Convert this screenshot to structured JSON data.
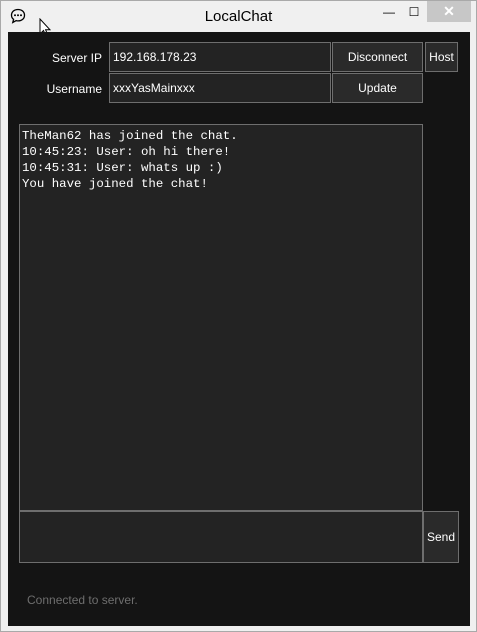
{
  "window": {
    "title": "LocalChat",
    "minimize_glyph": "—",
    "maximize_glyph": "☐",
    "close_glyph": "✕"
  },
  "form": {
    "server_ip_label": "Server IP",
    "server_ip_value": "192.168.178.23",
    "username_label": "Username",
    "username_value": "xxxYasMainxxx",
    "disconnect_label": "Disconnect",
    "host_label": "Host",
    "update_label": "Update"
  },
  "chat": {
    "lines": [
      "TheMan62 has joined the chat.",
      "10:45:23: User: oh hi there!",
      "10:45:31: User: whats up :)",
      "You have joined the chat!"
    ]
  },
  "composer": {
    "message_value": "",
    "send_label": "Send"
  },
  "status": {
    "text": "Connected to server."
  },
  "icons": {
    "app": "chat-bubble-icon",
    "cursor": "mouse-cursor-icon"
  },
  "colors": {
    "client_bg": "#141414",
    "field_bg": "#232323",
    "border": "#6e6e6e",
    "status_text": "#6e6e6e"
  }
}
